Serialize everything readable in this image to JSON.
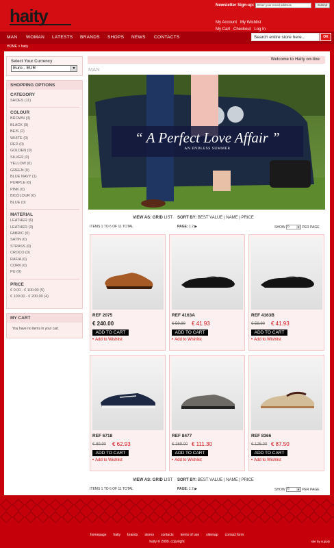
{
  "header": {
    "logo": "haity",
    "newsletter_label": "Newsletter Sign-up:",
    "newsletter_placeholder": "Enter your email address",
    "newsletter_button": "Submit",
    "account_links": [
      "My Account",
      "My Wishlist",
      "My Cart",
      "Checkout",
      "Log In"
    ]
  },
  "nav": {
    "items": [
      "MAN",
      "WOMAN",
      "LATESTS",
      "BRANDS",
      "SHOPS",
      "NEWS",
      "CONTACTS"
    ],
    "search_placeholder": "Search entire store here...",
    "search_button": "OK"
  },
  "breadcrumb": "HOME > haity",
  "sidebar": {
    "currency_label": "Select Your Currency",
    "currency_value": "Euro - EUR",
    "shopping_options_title": "SHOPPING OPTIONS",
    "category_heading": "CATEGORY",
    "category_items": [
      "SHOES (11)"
    ],
    "colour_heading": "COLOUR",
    "colour_items": [
      "BROWN (3)",
      "BLACK (9)",
      "BEIS (2)",
      "WHITE (0)",
      "RED (0)",
      "GOLDEN (0)",
      "SILVER (0)",
      "YELLOW (0)",
      "GREEN (0)",
      "BLUE NAVY (1)",
      "PURPLE (0)",
      "PINK (0)",
      "BICOLOUR (0)",
      "BLUE (0)"
    ],
    "material_heading": "MATERIAL",
    "material_items": [
      "LEATHER (6)",
      "LEATHER (3)",
      "FABRIC (0)",
      "SATIN (0)",
      "STRASS (0)",
      "CROCO (0)",
      "RAFIA (0)",
      "CORK (0)",
      "PU (0)"
    ],
    "price_heading": "PRICE",
    "price_items": [
      "€ 0.00 - € 100.00 (5)",
      "€ 100.00 - € 200.00 (4)"
    ],
    "cart_title": "MY CART",
    "cart_empty": "You have no items in your cart."
  },
  "welcome": "Welcome to Haity on-line",
  "category_title": "MAN",
  "banner": {
    "quote": "“ A Perfect Love Affair ”",
    "subtitle": "AN ENDLESS SUMMER"
  },
  "toolbar": {
    "view_as": "VIEW AS:",
    "grid": "GRID",
    "list": "LIST",
    "sort_by": "SORT BY:",
    "sort_options": [
      "BEST VALUE",
      "NAME",
      "PRICE"
    ],
    "items_count": "ITEMS 1 TO 6 OF 11 TOTAL",
    "page_label": "PAGE:",
    "pages": [
      "1",
      "2"
    ],
    "show_label": "SHOW",
    "show_value": "6",
    "per_page": "PER PAGE"
  },
  "products": [
    {
      "ref": "REF 2075",
      "price": "€ 240.00",
      "old_price": "",
      "new_price": "",
      "add": "ADD TO CART",
      "wish": "Add to Wishlist",
      "shoe": "brown-oxford"
    },
    {
      "ref": "REF 4163A",
      "price": "",
      "old_price": "€ 59.90",
      "new_price": "€ 41.93",
      "add": "ADD TO CART",
      "wish": "Add to Wishlist",
      "shoe": "black-loafer"
    },
    {
      "ref": "REF 4163B",
      "price": "",
      "old_price": "€ 59.90",
      "new_price": "€ 41.93",
      "add": "ADD TO CART",
      "wish": "Add to Wishlist",
      "shoe": "black-loafer"
    },
    {
      "ref": "REF 6718",
      "price": "",
      "old_price": "€ 89.90",
      "new_price": "€ 62.93",
      "add": "ADD TO CART",
      "wish": "Add to Wishlist",
      "shoe": "navy-boat"
    },
    {
      "ref": "REF 8477",
      "price": "",
      "old_price": "€ 159.00",
      "new_price": "€ 111.30",
      "add": "ADD TO CART",
      "wish": "Add to Wishlist",
      "shoe": "grey-sneaker"
    },
    {
      "ref": "REF 8366",
      "price": "",
      "old_price": "€ 125.00",
      "new_price": "€ 87.50",
      "add": "ADD TO CART",
      "wish": "Add to Wishlist",
      "shoe": "beige-loafer"
    }
  ],
  "footer": {
    "links": [
      "homepage",
      "haity",
      "brands",
      "stores",
      "contacts",
      "terms of use",
      "sitemap",
      "contact form"
    ],
    "copyright": "haity © 2009. copyright",
    "credit": "site by supply"
  },
  "colors": {
    "brand_red": "#d40d12",
    "dark_red": "#a8000a",
    "panel_pink": "#fdeeee"
  }
}
